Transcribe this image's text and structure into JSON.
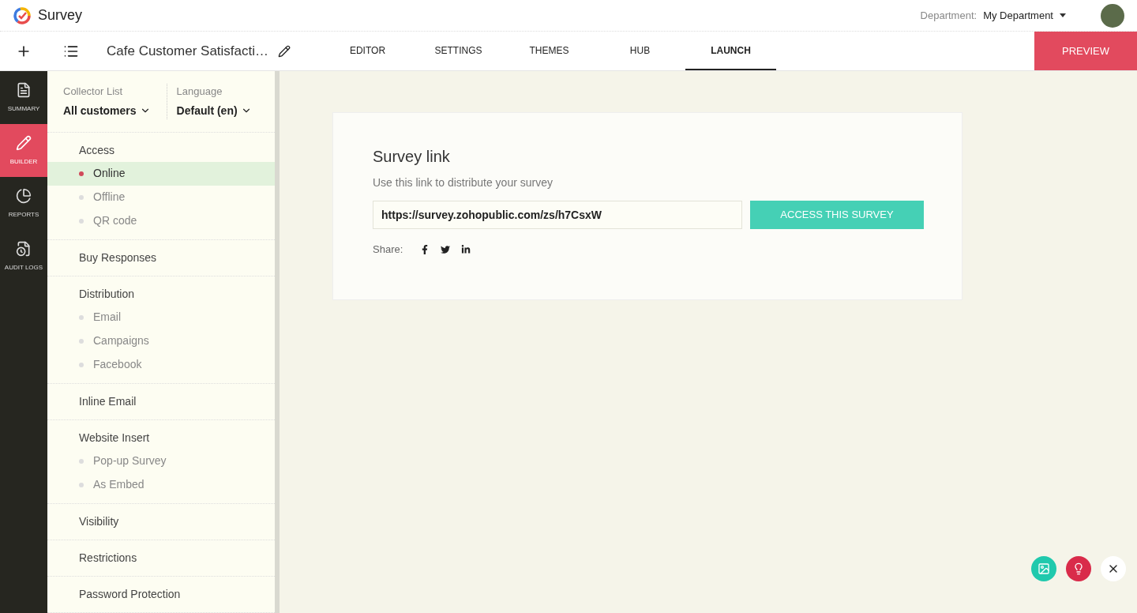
{
  "app": {
    "name": "Survey",
    "department_label": "Department:",
    "department": "My Department"
  },
  "toolbar": {
    "survey_title": "Cafe Customer Satisfacti…",
    "preview": "PREVIEW"
  },
  "tabs": [
    {
      "label": "EDITOR",
      "selected": false
    },
    {
      "label": "SETTINGS",
      "selected": false
    },
    {
      "label": "THEMES",
      "selected": false
    },
    {
      "label": "HUB",
      "selected": false
    },
    {
      "label": "LAUNCH",
      "selected": true
    }
  ],
  "rail": [
    {
      "kind": "summary",
      "label": "SUMMARY",
      "selected": false
    },
    {
      "kind": "builder",
      "label": "BUILDER",
      "selected": true
    },
    {
      "kind": "reports",
      "label": "REPORTS",
      "selected": false
    },
    {
      "kind": "audit",
      "label": "AUDIT LOGS",
      "selected": false
    }
  ],
  "filters": [
    {
      "label": "Collector List",
      "value": "All customers"
    },
    {
      "label": "Language",
      "value": "Default (en)"
    }
  ],
  "nav": [
    {
      "label": "Access",
      "children": [
        {
          "label": "Online",
          "selected": true
        },
        {
          "label": "Offline",
          "selected": false
        },
        {
          "label": "QR code",
          "selected": false
        }
      ]
    },
    {
      "label": "Buy Responses"
    },
    {
      "label": "Distribution",
      "children": [
        {
          "label": "Email",
          "selected": false
        },
        {
          "label": "Campaigns",
          "selected": false
        },
        {
          "label": "Facebook",
          "selected": false
        }
      ]
    },
    {
      "label": "Inline Email"
    },
    {
      "label": "Website Insert",
      "children": [
        {
          "label": "Pop-up Survey",
          "selected": false
        },
        {
          "label": "As Embed",
          "selected": false
        }
      ]
    },
    {
      "label": "Visibility"
    },
    {
      "label": "Restrictions"
    },
    {
      "label": "Password Protection"
    }
  ],
  "card": {
    "title": "Survey link",
    "subtitle": "Use this link to distribute your survey",
    "link": "https://survey.zohopublic.com/zs/h7CsxW",
    "button": "ACCESS THIS SURVEY",
    "share_label": "Share:"
  }
}
